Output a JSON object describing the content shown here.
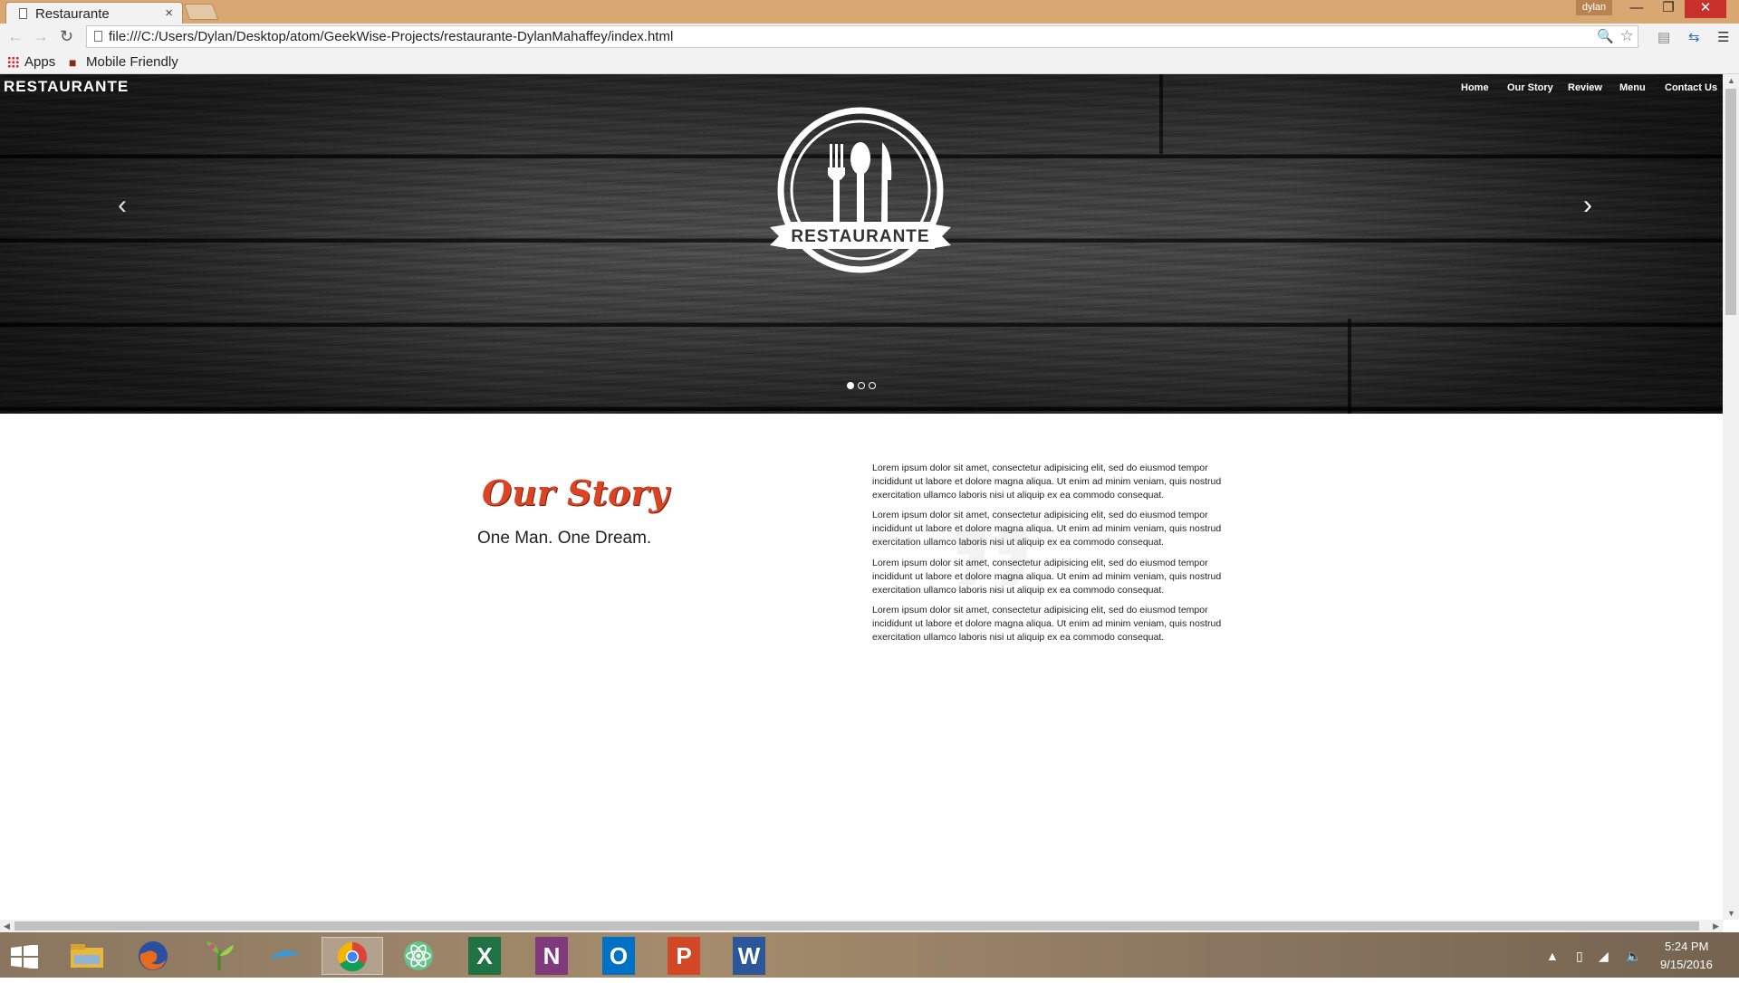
{
  "browser": {
    "tab_title": "Restaurante",
    "tab_close": "×",
    "user_badge": "dylan",
    "url": "file:///C:/Users/Dylan/Desktop/atom/GeekWise-Projects/restaurante-DylanMahaffey/index.html",
    "bookmarks": [
      {
        "label": "Apps",
        "icon": "apps-grid-icon"
      },
      {
        "label": "Mobile Friendly",
        "icon": "mobile-friendly-icon"
      }
    ]
  },
  "page": {
    "brand": "RESTAURANTE",
    "nav": [
      "Home",
      "Our Story",
      "Review",
      "Menu",
      "Contact Us"
    ],
    "logo_text": "RESTAURANTE",
    "carousel": {
      "active_slide": 1,
      "slide_count": 3,
      "prev_icon": "‹",
      "next_icon": "›"
    },
    "story": {
      "title": "Our Story",
      "subtitle": "One Man. One Dream.",
      "watermark": "”",
      "paragraphs": [
        "Lorem ipsum dolor sit amet, consectetur adipisicing elit, sed do eiusmod tempor incididunt ut labore et dolore magna aliqua. Ut enim ad minim veniam, quis nostrud exercitation ullamco laboris nisi ut aliquip ex ea commodo consequat.",
        "Lorem ipsum dolor sit amet, consectetur adipisicing elit, sed do eiusmod tempor incididunt ut labore et dolore magna aliqua. Ut enim ad minim veniam, quis nostrud exercitation ullamco laboris nisi ut aliquip ex ea commodo consequat.",
        "Lorem ipsum dolor sit amet, consectetur adipisicing elit, sed do eiusmod tempor incididunt ut labore et dolore magna aliqua. Ut enim ad minim veniam, quis nostrud exercitation ullamco laboris nisi ut aliquip ex ea commodo consequat.",
        "Lorem ipsum dolor sit amet, consectetur adipisicing elit, sed do eiusmod tempor incididunt ut labore et dolore magna aliqua. Ut enim ad minim veniam, quis nostrud exercitation ullamco laboris nisi ut aliquip ex ea commodo consequat."
      ]
    }
  },
  "taskbar": {
    "apps": [
      {
        "name": "file-explorer-icon",
        "glyph": ""
      },
      {
        "name": "firefox-icon",
        "glyph": ""
      },
      {
        "name": "plant-app-icon",
        "glyph": ""
      },
      {
        "name": "dolphin-app-icon",
        "glyph": ""
      },
      {
        "name": "chrome-icon",
        "glyph": "",
        "active": true
      },
      {
        "name": "atom-icon",
        "glyph": ""
      },
      {
        "name": "excel-icon",
        "glyph": "X"
      },
      {
        "name": "onenote-icon",
        "glyph": "N"
      },
      {
        "name": "outlook-icon",
        "glyph": "O"
      },
      {
        "name": "powerpoint-icon",
        "glyph": "P"
      },
      {
        "name": "word-icon",
        "glyph": "W"
      }
    ],
    "time": "5:24 PM",
    "date": "9/15/2016"
  },
  "colors": {
    "accent_red": "#d94425",
    "titlebar": "#d8a772",
    "close_button": "#c7302b"
  }
}
